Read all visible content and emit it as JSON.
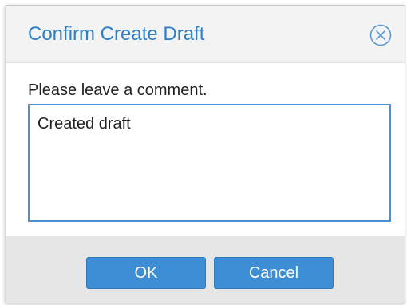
{
  "dialog": {
    "title": "Confirm Create Draft",
    "close_icon": "close-circle-icon",
    "prompt": "Please leave a comment.",
    "comment_value": "Created draft",
    "ok_label": "OK",
    "cancel_label": "Cancel"
  },
  "colors": {
    "accent": "#2e7fc6",
    "button": "#3e8ed6",
    "field_border": "#4b90d2",
    "header_bg": "#f3f3f3",
    "footer_bg": "#e6e6e6"
  }
}
